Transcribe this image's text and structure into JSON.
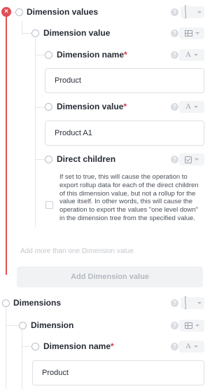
{
  "dimension_values": {
    "label": "Dimension values",
    "type_glyph": "[ ]",
    "remove_glyph": "×",
    "help_glyph": "?",
    "item": {
      "label": "Dimension value",
      "dimension_name": {
        "label": "Dimension name",
        "required_mark": "*",
        "type_glyph": "A",
        "value": "Product"
      },
      "dimension_value": {
        "label": "Dimension value",
        "required_mark": "*",
        "type_glyph": "A",
        "value": "Product A1"
      },
      "direct_children": {
        "label": "Direct children",
        "description": "If set to true, this will cause the operation to export rollup data for each of the direct children of this dimension value, but not a rollup for the value itself. In other words, this will cause the operation to export the values \"one level down\" in the dimension tree from the specified value."
      }
    },
    "add_more_hint": "Add more than one Dimension value",
    "add_button_label": "Add Dimension value"
  },
  "dimensions": {
    "label": "Dimensions",
    "type_glyph": "[ ]",
    "item": {
      "label": "Dimension",
      "dimension_name": {
        "label": "Dimension name",
        "required_mark": "*",
        "type_glyph": "A",
        "value": "Product"
      }
    }
  },
  "colors": {
    "remove_red": "#e04f58",
    "required_red": "#d8364a",
    "line_red": "#e05252"
  }
}
